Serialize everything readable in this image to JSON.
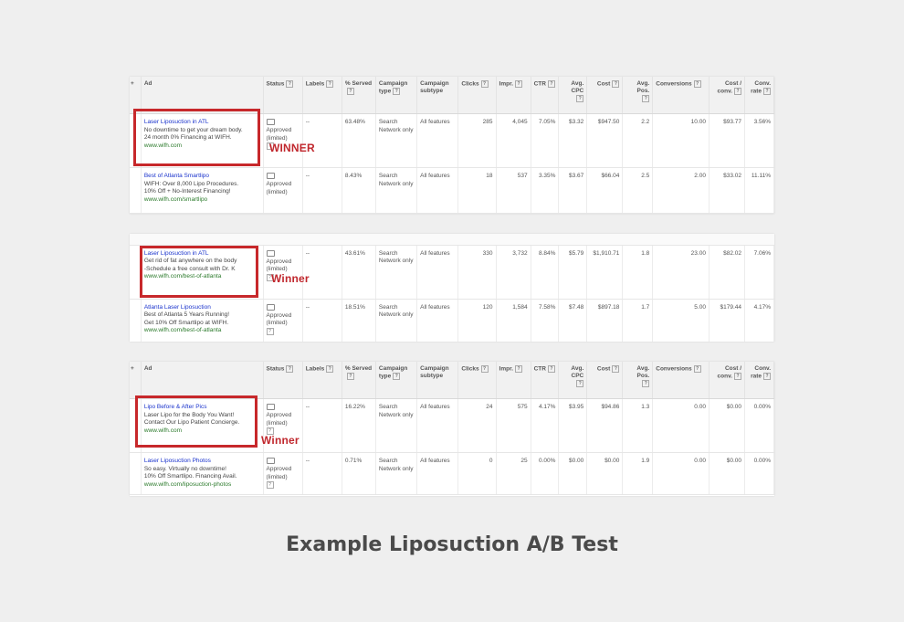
{
  "headers": [
    "Ad",
    "Status",
    "Labels",
    "% Served",
    "Campaign type",
    "Campaign subtype",
    "Clicks",
    "Impr.",
    "CTR",
    "Avg. CPC",
    "Cost",
    "Avg. Pos.",
    "Conversions",
    "Cost / conv.",
    "Conv. rate"
  ],
  "header_arrow": "+",
  "tables": [
    {
      "winner_label": "WINNER",
      "rows": [
        {
          "title": "Laser Liposuction in ATL",
          "line1": "No downtime to get your dream body.",
          "line2": "24 month 0% Financing at WIFH.",
          "url": "www.wifh.com",
          "status": "Approved (limited)",
          "labels": "--",
          "served": "63.48%",
          "ctype": "Search Network only",
          "csub": "All features",
          "clicks": "285",
          "impr": "4,045",
          "ctr": "7.05%",
          "cpc": "$3.32",
          "cost": "$947.50",
          "pos": "2.2",
          "conv": "10.00",
          "costconv": "$93.77",
          "convrate": "3.56%"
        },
        {
          "title": "Best of Atlanta Smartlipo",
          "line1": "WIFH: Over 8,000 Lipo Procedures.",
          "line2": "10% Off + No-Interest Financing!",
          "url": "www.wifh.com/smartlipo",
          "status": "Approved (limited)",
          "labels": "--",
          "served": "8.43%",
          "ctype": "Search Network only",
          "csub": "All features",
          "clicks": "18",
          "impr": "537",
          "ctr": "3.35%",
          "cpc": "$3.67",
          "cost": "$66.04",
          "pos": "2.5",
          "conv": "2.00",
          "costconv": "$33.02",
          "convrate": "11.11%"
        }
      ]
    },
    {
      "winner_label": "Winner",
      "rows": [
        {
          "title": "Laser Liposuction in ATL",
          "line1": "Get rid of fat anywhere on the body",
          "line2": "-Schedule a free consult with Dr. K",
          "url": "www.wifh.com/best-of-atlanta",
          "status": "Approved (limited)",
          "labels": "--",
          "served": "43.61%",
          "ctype": "Search Network only",
          "csub": "All features",
          "clicks": "330",
          "impr": "3,732",
          "ctr": "8.84%",
          "cpc": "$5.79",
          "cost": "$1,910.71",
          "pos": "1.8",
          "conv": "23.00",
          "costconv": "$82.02",
          "convrate": "7.06%"
        },
        {
          "title": "Atlanta Laser Liposuction",
          "line1": "Best of Atlanta 5 Years Running!",
          "line2": "Get 10% Off Smartlipo at WIFH.",
          "url": "www.wifh.com/best-of-atlanta",
          "status": "Approved (limited)",
          "labels": "--",
          "served": "18.51%",
          "ctype": "Search Network only",
          "csub": "All features",
          "clicks": "120",
          "impr": "1,584",
          "ctr": "7.58%",
          "cpc": "$7.48",
          "cost": "$897.18",
          "pos": "1.7",
          "conv": "5.00",
          "costconv": "$179.44",
          "convrate": "4.17%"
        }
      ]
    },
    {
      "winner_label": "Winner",
      "rows": [
        {
          "title": "Lipo Before & After Pics",
          "line1": "Laser Lipo for the Body You Want!",
          "line2": "Contact Our Lipo Patient Concierge.",
          "url": "www.wifh.com",
          "status": "Approved (limited)",
          "labels": "--",
          "served": "16.22%",
          "ctype": "Search Network only",
          "csub": "All features",
          "clicks": "24",
          "impr": "575",
          "ctr": "4.17%",
          "cpc": "$3.95",
          "cost": "$94.86",
          "pos": "1.3",
          "conv": "0.00",
          "costconv": "$0.00",
          "convrate": "0.00%"
        },
        {
          "title": "Laser Liposuction Photos",
          "line1": "So easy. Virtually no downtime!",
          "line2": "10% Off Smartlipo. Financing Avail.",
          "url": "www.wifh.com/liposuction-photos",
          "status": "Approved (limited)",
          "labels": "--",
          "served": "0.71%",
          "ctype": "Search Network only",
          "csub": "All features",
          "clicks": "0",
          "impr": "25",
          "ctr": "0.00%",
          "cpc": "$0.00",
          "cost": "$0.00",
          "pos": "1.9",
          "conv": "0.00",
          "costconv": "$0.00",
          "convrate": "0.00%"
        }
      ]
    }
  ],
  "caption": "Example Liposuction A/B Test"
}
